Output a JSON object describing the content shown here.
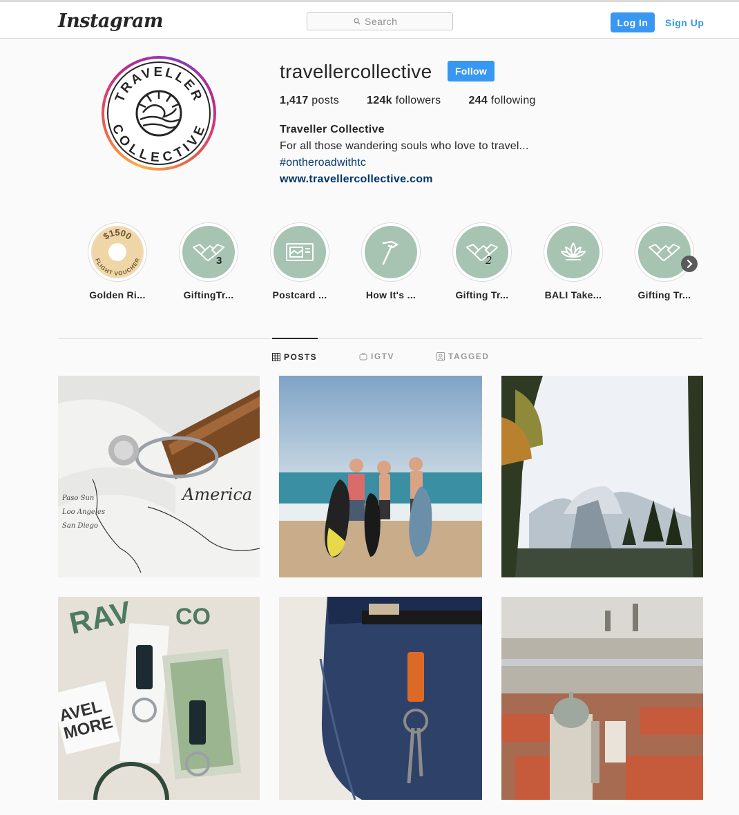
{
  "header": {
    "logo": "Instagram",
    "search_placeholder": "Search",
    "login_label": "Log In",
    "signup_label": "Sign Up"
  },
  "profile": {
    "username": "travellercollective",
    "follow_label": "Follow",
    "stats": [
      {
        "count": "1,417",
        "label": "posts"
      },
      {
        "count": "124k",
        "label": "followers"
      },
      {
        "count": "244",
        "label": "following"
      }
    ],
    "full_name": "Traveller Collective",
    "bio": "For all those wandering souls who love to travel...",
    "hashtag": "#ontheroadwithtc",
    "website": "www.travellercollective.com",
    "avatar_text": {
      "top": "TRAVELLER",
      "bottom": "COLLECTIVE"
    }
  },
  "highlights": [
    {
      "label": "Golden Ri...",
      "icon": "flight-voucher-icon",
      "voucher_amount": "$1500",
      "voucher_text": "FLIGHT VOUCHER"
    },
    {
      "label": "GiftingTr...",
      "icon": "handshake-icon",
      "badge": "3"
    },
    {
      "label": "Postcard ...",
      "icon": "postcard-icon"
    },
    {
      "label": "How It's ...",
      "icon": "hammer-icon"
    },
    {
      "label": "Gifting Tr...",
      "icon": "handshake-icon",
      "badge": "2"
    },
    {
      "label": "BALI Take...",
      "icon": "lotus-icon"
    },
    {
      "label": "Gifting Tr...",
      "icon": "handshake-icon"
    }
  ],
  "tabs": [
    {
      "label": "POSTS",
      "icon": "grid-icon",
      "active": true
    },
    {
      "label": "IGTV",
      "icon": "igtv-icon",
      "active": false
    },
    {
      "label": "TAGGED",
      "icon": "tagged-icon",
      "active": false
    }
  ],
  "posts": [
    {
      "subject": "keyring-on-map",
      "map_text": "America"
    },
    {
      "subject": "surfers-on-beach"
    },
    {
      "subject": "half-dome-mountain"
    },
    {
      "subject": "gift-box-keyrings"
    },
    {
      "subject": "jeans-keychain"
    },
    {
      "subject": "prague-city"
    }
  ],
  "colors": {
    "accent": "#3897f0",
    "link": "#003569",
    "highlight_bg": "#a7c3b2"
  }
}
